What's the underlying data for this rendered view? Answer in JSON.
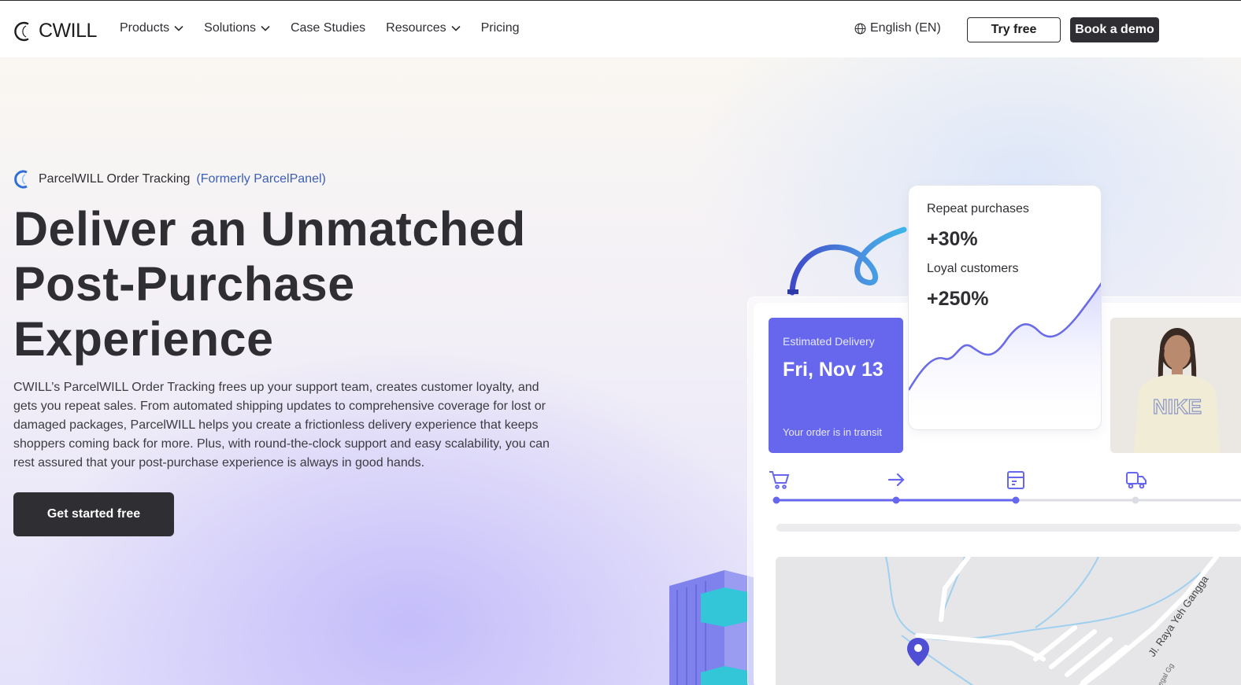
{
  "header": {
    "logo_text": "CWILL",
    "nav": [
      {
        "label": "Products",
        "has_dropdown": true
      },
      {
        "label": "Solutions",
        "has_dropdown": true
      },
      {
        "label": "Case Studies",
        "has_dropdown": false
      },
      {
        "label": "Resources",
        "has_dropdown": true
      },
      {
        "label": "Pricing",
        "has_dropdown": false
      }
    ],
    "language": "English (EN)",
    "try_free": "Try free",
    "book_demo": "Book a demo"
  },
  "hero": {
    "eyebrow": "ParcelWILL Order Tracking",
    "eyebrow_accent": "(Formerly ParcelPanel)",
    "headline_lines": [
      "Deliver an Unmatched",
      "Post-Purchase",
      "Experience"
    ],
    "description": "CWILL’s ParcelWILL Order Tracking frees up your support team, creates customer loyalty, and gets you repeat sales. From automated shipping updates to comprehensive coverage for lost or damaged packages, ParcelWILL helps you create a frictionless delivery experience that keeps shoppers coming back for more. Plus, with round-the-clock support and easy scalability, you can rest assured that your post-purchase experience is always in good hands.",
    "cta": "Get started free"
  },
  "visual": {
    "delivery_card": {
      "label": "Estimated Delivery",
      "date": "Fri, Nov 13",
      "status": "Your order is in transit"
    },
    "stats": {
      "label1": "Repeat purchases",
      "value1": "+30%",
      "label2": "Loyal customers",
      "value2": "+250%"
    },
    "photo_shirt_text": "NIKE",
    "steps": [
      "cart-icon",
      "arrow-right-icon",
      "package-icon",
      "truck-icon"
    ],
    "progress_completed_steps": 3,
    "progress_total_steps": 4,
    "map_street_label": "Jl. Raya Yeh Gangga",
    "map_street_label2": "egal Gg"
  },
  "colors": {
    "accent": "#6667ec",
    "dark_button": "#2e2e33",
    "link_blue": "#3b5fb8"
  }
}
